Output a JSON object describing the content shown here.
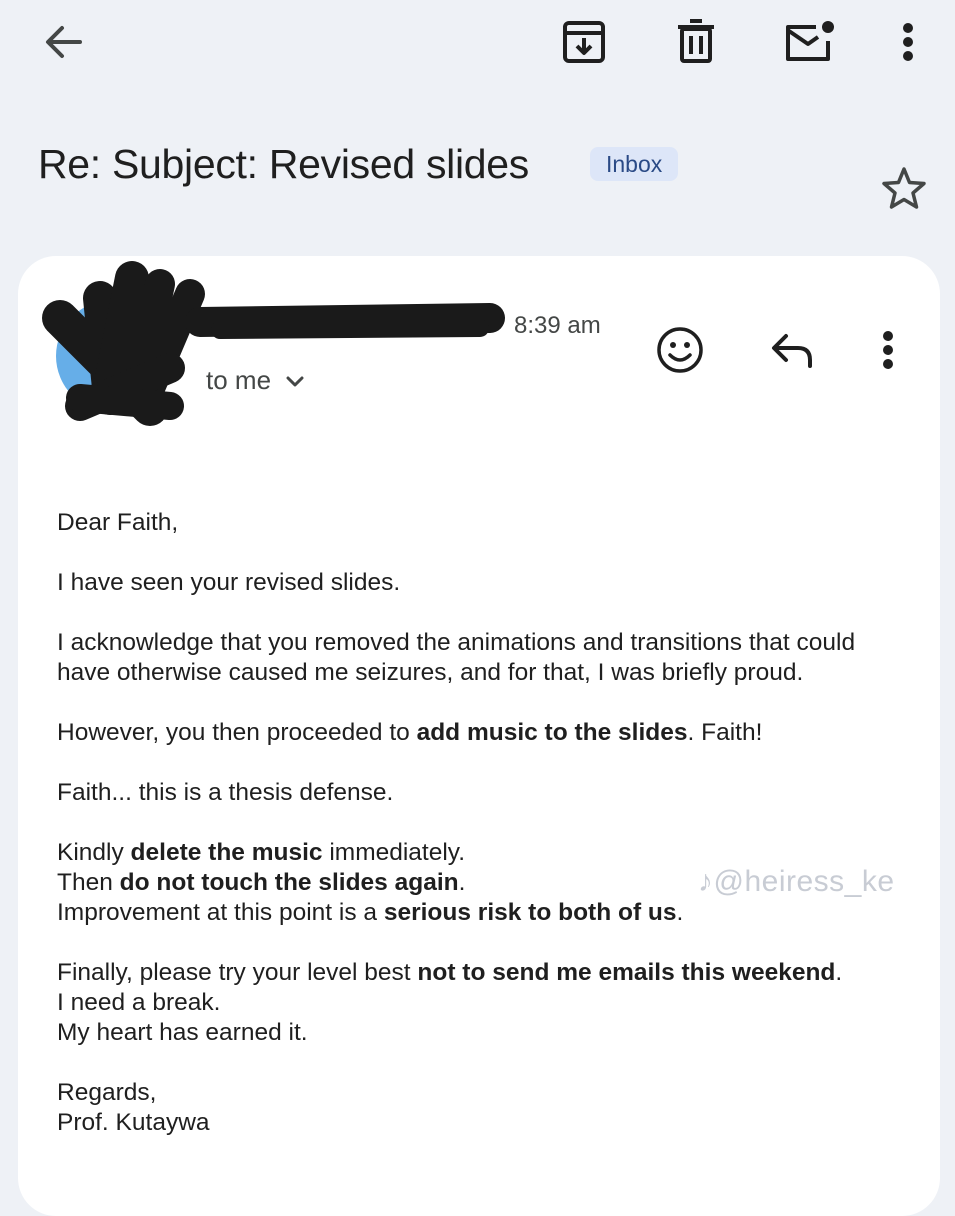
{
  "toolbar": {
    "back_icon": "arrow-back-icon",
    "archive_icon": "archive-icon",
    "delete_icon": "trash-icon",
    "mark_unread_icon": "mail-unread-icon",
    "more_icon": "more-vertical-icon"
  },
  "email": {
    "subject": "Re: Subject: Revised slides",
    "label": "Inbox",
    "star_icon": "star-outline-icon"
  },
  "message": {
    "time": "8:39 am",
    "recipient": "to me",
    "emoji_icon": "add-reaction-icon",
    "reply_icon": "reply-icon",
    "more_icon": "more-vertical-icon",
    "avatar_color": "#66aee8"
  },
  "body": {
    "greeting": "Dear Faith,",
    "p1": "I have seen your revised slides.",
    "p2_line1": "I acknowledge that you removed the animations and transitions that could",
    "p2_line2": "have otherwise caused me seizures, and for that, I was briefly proud.",
    "p3_pre": "However, you then proceeded to ",
    "p3_bold": "add music to the slides",
    "p3_post": ". Faith!",
    "p4": "Faith... this is a thesis defense.",
    "p5_l1_pre": "Kindly ",
    "p5_l1_bold": "delete the music",
    "p5_l1_post": " immediately.",
    "p5_l2_pre": "Then ",
    "p5_l2_bold": "do not touch the slides again",
    "p5_l2_post": ".",
    "p5_l3_pre": "Improvement at this point is a ",
    "p5_l3_bold": "serious risk to both of us",
    "p5_l3_post": ".",
    "p6_l1_pre": "Finally, please try your level best ",
    "p6_l1_bold": "not to send me emails this weekend",
    "p6_l1_post": ".",
    "p6_l2": "I need a break.",
    "p6_l3": "My heart has earned it.",
    "signoff": "Regards,",
    "signature": "Prof. Kutaywa"
  },
  "watermark": "@heiress_ke"
}
